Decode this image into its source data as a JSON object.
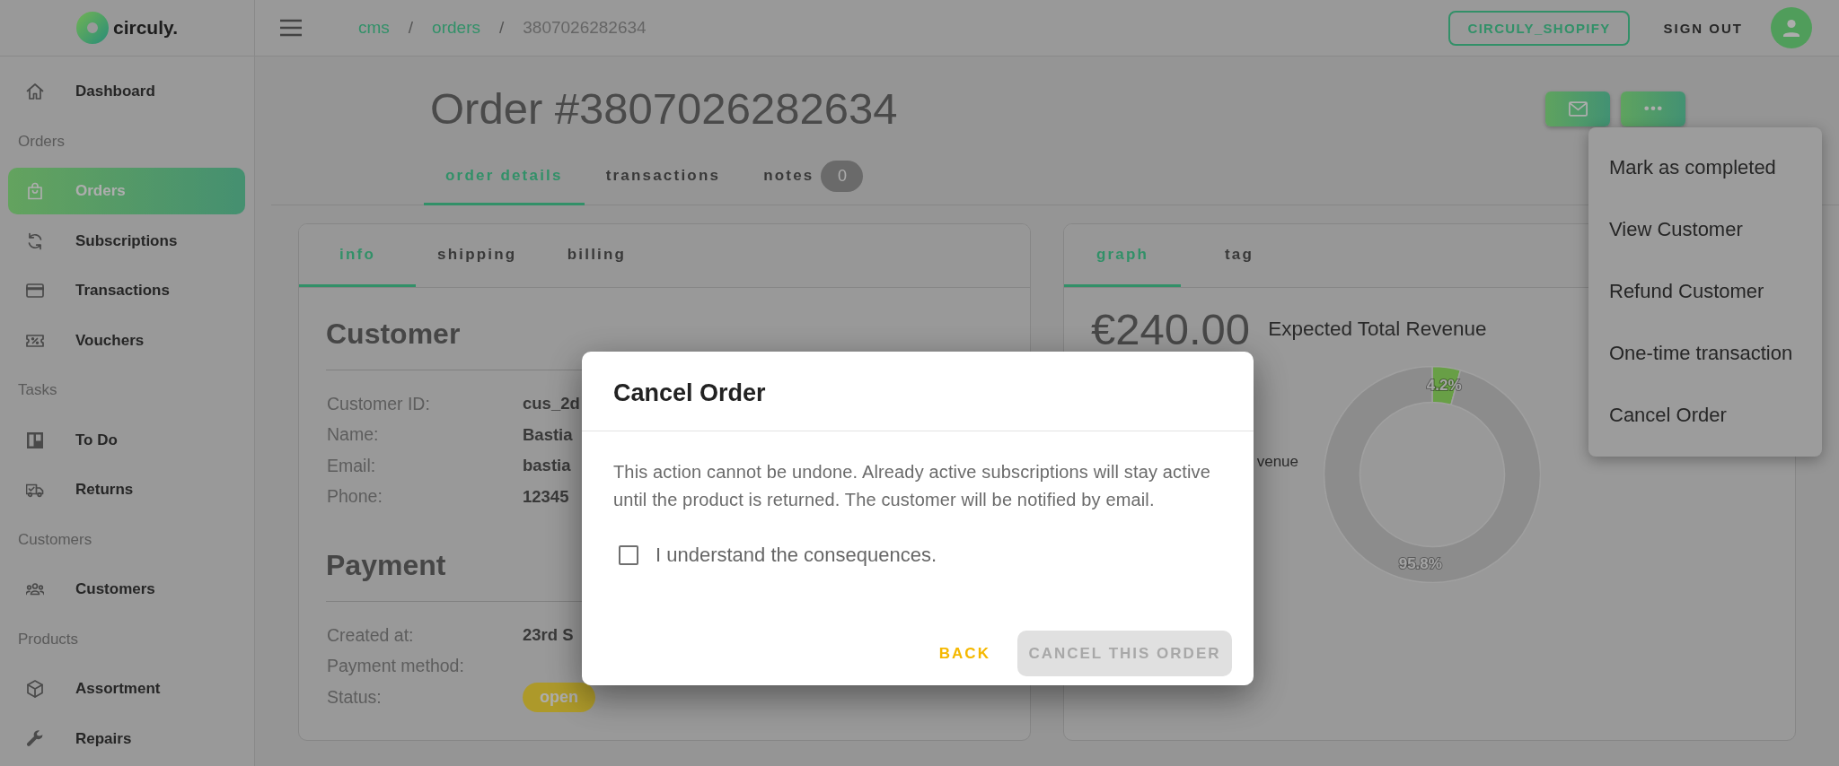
{
  "logo": {
    "text": "circuly."
  },
  "sidebar": {
    "groups": [
      {
        "items": [
          {
            "label": "Dashboard",
            "selected": false
          }
        ]
      },
      {
        "title": "Orders",
        "items": [
          {
            "label": "Orders",
            "selected": true
          },
          {
            "label": "Subscriptions",
            "selected": false
          },
          {
            "label": "Transactions",
            "selected": false
          },
          {
            "label": "Vouchers",
            "selected": false
          }
        ]
      },
      {
        "title": "Tasks",
        "items": [
          {
            "label": "To Do",
            "selected": false
          },
          {
            "label": "Returns",
            "selected": false
          }
        ]
      },
      {
        "title": "Customers",
        "items": [
          {
            "label": "Customers",
            "selected": false
          }
        ]
      },
      {
        "title": "Products",
        "items": [
          {
            "label": "Assortment",
            "selected": false
          },
          {
            "label": "Repairs",
            "selected": false
          }
        ]
      }
    ]
  },
  "header": {
    "breadcrumb": [
      {
        "kind": "link",
        "label": "cms"
      },
      {
        "kind": "link",
        "separator": "/",
        "label": "orders"
      },
      {
        "kind": "current",
        "separator": "/",
        "label": "3807026282634"
      }
    ],
    "shop_button": "CIRCULY_SHOPIFY",
    "sign_out": "SIGN OUT"
  },
  "order": {
    "title": "Order #3807026282634",
    "tabs": [
      {
        "label": "order details",
        "selected": true
      },
      {
        "label": "transactions",
        "selected": false
      },
      {
        "label": "notes",
        "selected": false,
        "badge": "0"
      }
    ],
    "menu": {
      "items": [
        {
          "label": "Mark as completed"
        },
        {
          "label": "View Customer"
        },
        {
          "label": "Refund Customer"
        },
        {
          "label": "One-time transaction"
        },
        {
          "label": "Cancel Order"
        }
      ]
    }
  },
  "info_card": {
    "tabs": [
      {
        "label": "info",
        "selected": true
      },
      {
        "label": "shipping",
        "selected": false
      },
      {
        "label": "billing",
        "selected": false
      }
    ],
    "sections": [
      {
        "title": "Customer",
        "rows": [
          {
            "kind": "text",
            "label": "Customer ID:",
            "value": "cus_2d"
          },
          {
            "kind": "text",
            "label": "Name:",
            "value": "Bastia"
          },
          {
            "kind": "text",
            "label": "Email:",
            "value": "bastia"
          },
          {
            "kind": "text",
            "label": "Phone:",
            "value": "12345"
          }
        ]
      },
      {
        "title": "Payment",
        "rows": [
          {
            "kind": "text",
            "label": "Created at:",
            "value": "23rd S"
          },
          {
            "kind": "text",
            "label": "Payment method:"
          },
          {
            "kind": "badge",
            "label": "Status:",
            "value": "open"
          }
        ]
      }
    ]
  },
  "graph_card": {
    "tabs": [
      {
        "label": "graph",
        "selected": true
      },
      {
        "label": "tag",
        "selected": false
      }
    ],
    "amount": "€240.00",
    "amount_label": "Expected Total Revenue",
    "legend": [
      "venue"
    ],
    "chart_data": {
      "type": "donut",
      "values": [
        4.2,
        95.8
      ],
      "value_labels": [
        "4.2%",
        "95.8%"
      ]
    }
  },
  "dialog": {
    "title": "Cancel Order",
    "message": "This action cannot be undone. Already active subscriptions will stay active until the product is returned. The customer will be notified by email.",
    "checkbox": {
      "label": "I understand the consequences.",
      "checked": false
    },
    "buttons": [
      {
        "kind": "text",
        "label": "BACK",
        "disabled": false
      },
      {
        "kind": "contained",
        "label": "CANCEL THIS ORDER",
        "disabled": true
      }
    ]
  }
}
